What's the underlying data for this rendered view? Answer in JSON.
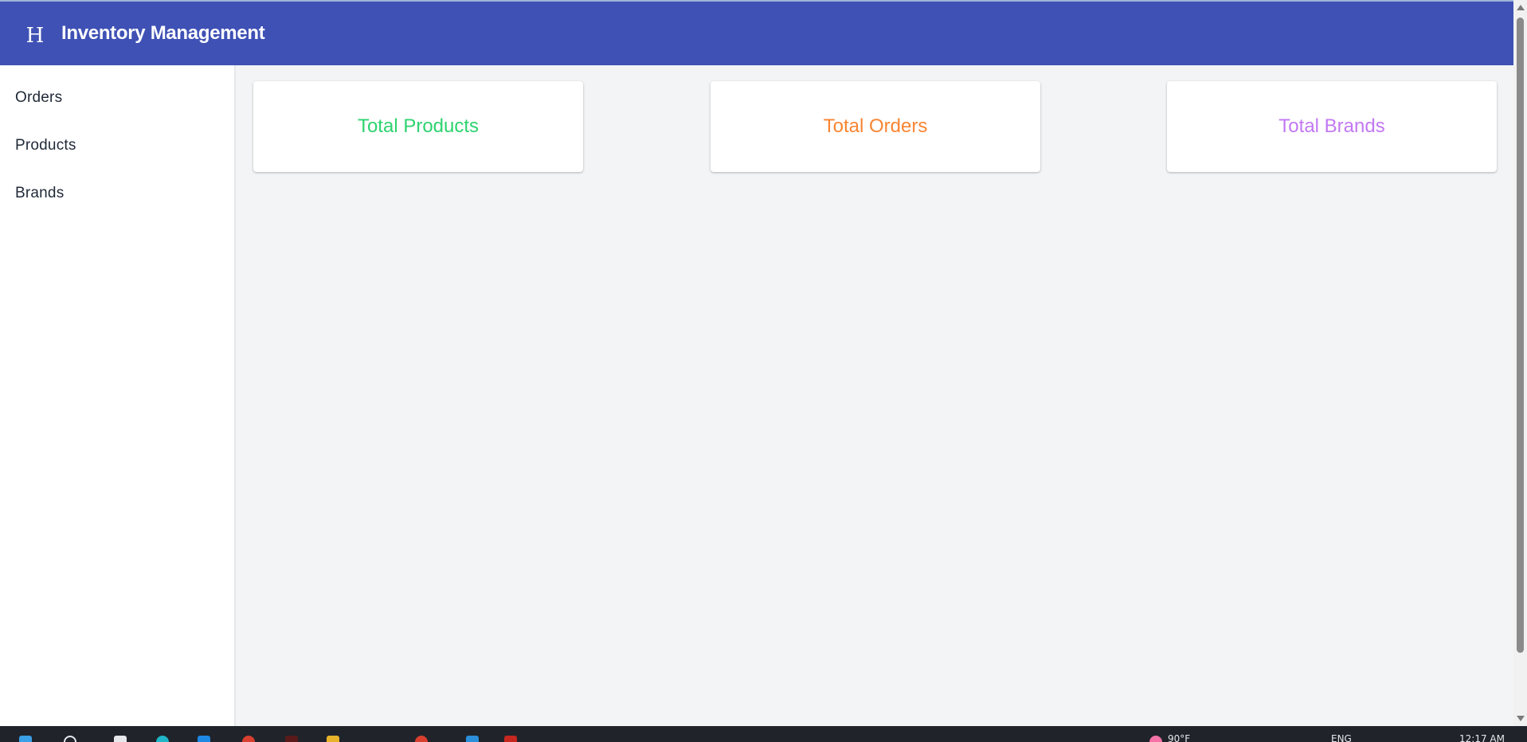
{
  "header": {
    "logo_letter": "H",
    "title": "Inventory Management",
    "background": "#3f51b5"
  },
  "sidebar": {
    "items": [
      {
        "label": "Orders"
      },
      {
        "label": "Products"
      },
      {
        "label": "Brands"
      }
    ]
  },
  "cards": [
    {
      "label": "Total Products",
      "color": "#2dd36f"
    },
    {
      "label": "Total Orders",
      "color": "#f98533"
    },
    {
      "label": "Total Brands",
      "color": "#c278f2"
    }
  ],
  "taskbar": {
    "temperature": "90°F",
    "language": "ENG",
    "time": "12:17 AM",
    "icons": [
      "windows-start-icon",
      "search-icon",
      "task-view-icon",
      "edge-icon",
      "file-explorer-icon",
      "chrome-icon",
      "app-icon",
      "folder-icon",
      "chrome-active-icon",
      "vscode-icon",
      "app-red-icon",
      "weather-icon"
    ]
  }
}
